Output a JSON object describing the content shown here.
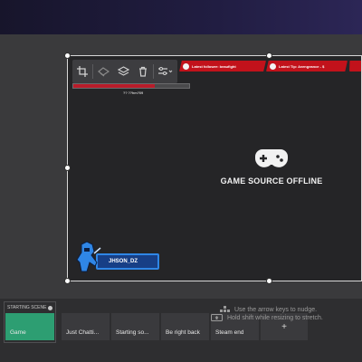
{
  "canvas": {
    "toolbar": {
      "icons": [
        "crop-icon",
        "filter-icon",
        "layers-icon",
        "trash-icon",
        "adjust-icon"
      ]
    },
    "alerts": [
      {
        "text": "Latest follower: beaufight"
      },
      {
        "text": "Latest Tip: Avengeance - $"
      },
      {
        "text": ""
      }
    ],
    "health_bar": {
      "name": "?? ??hm?09",
      "fill_percent": 70,
      "fill_color": "#b81c2a"
    },
    "offline": {
      "title": "GAME SOURCE OFFLINE",
      "icon": "gamepad-icon"
    },
    "logo": {
      "text": "JHSON_DZ"
    }
  },
  "scenes": {
    "header": "STARTING SCENE",
    "items": [
      {
        "label": "Game",
        "active": true
      },
      {
        "label": "Just Chatti...",
        "active": false
      },
      {
        "label": "Starting so...",
        "active": false
      },
      {
        "label": "Be right back",
        "active": false
      },
      {
        "label": "Steam end",
        "active": false
      }
    ],
    "add_label": "+"
  },
  "tips": {
    "nudge": "Use the arrow keys to nudge.",
    "stretch": "Hold shift while resizing to stretch."
  },
  "colors": {
    "accent": "#2d9e72",
    "alert_red": "#c2121b",
    "logo_blue": "#2f86e6",
    "topbar": "#211d42"
  }
}
